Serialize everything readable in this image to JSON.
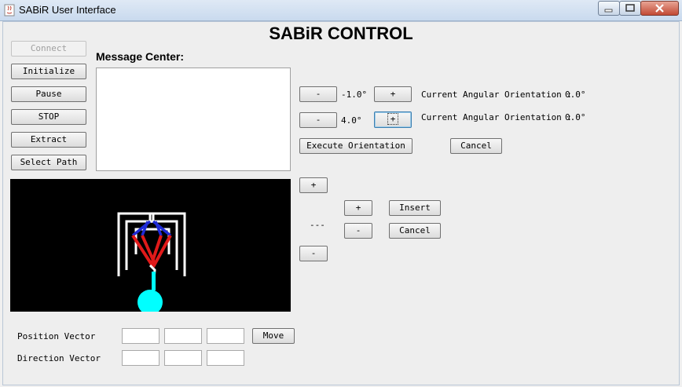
{
  "window": {
    "title": "SABiR User Interface",
    "min_icon": "minimize-icon",
    "max_icon": "maximize-icon",
    "close_icon": "close-icon"
  },
  "heading": "SABiR CONTROL",
  "left_buttons": [
    {
      "label": "Connect",
      "enabled": false
    },
    {
      "label": "Initialize",
      "enabled": true
    },
    {
      "label": "Pause",
      "enabled": true
    },
    {
      "label": "STOP",
      "enabled": true
    },
    {
      "label": "Extract",
      "enabled": true
    },
    {
      "label": "Select Path",
      "enabled": true
    }
  ],
  "message_center": {
    "label": "Message Center:",
    "content": ""
  },
  "orientation": {
    "rows": [
      {
        "minus": "-",
        "value": "-1.0°",
        "plus": "+",
        "label": "Current Angular Orientation :",
        "current": "0.0°"
      },
      {
        "minus": "-",
        "value": "4.0°",
        "plus": "+",
        "label": "Current Angular Orientation :",
        "current": "0.0°"
      }
    ],
    "execute": "Execute Orientation",
    "cancel": "Cancel"
  },
  "insertion": {
    "outer_plus": "+",
    "outer_minus": "-",
    "value": "---",
    "inner_plus": "+",
    "inner_minus": "-",
    "insert": "Insert",
    "cancel": "Cancel"
  },
  "vectors": {
    "position_label": "Position Vector",
    "direction_label": "Direction Vector",
    "move": "Move",
    "position_values": [
      "",
      "",
      ""
    ],
    "direction_values": [
      "",
      "",
      ""
    ]
  },
  "colors": {
    "canvas_bg": "#000000",
    "frame": "#ffffff",
    "upper_links": "#1f2bd6",
    "lower_links": "#e01a1a",
    "needle": "#ffffff",
    "tip": "#00ffff"
  }
}
